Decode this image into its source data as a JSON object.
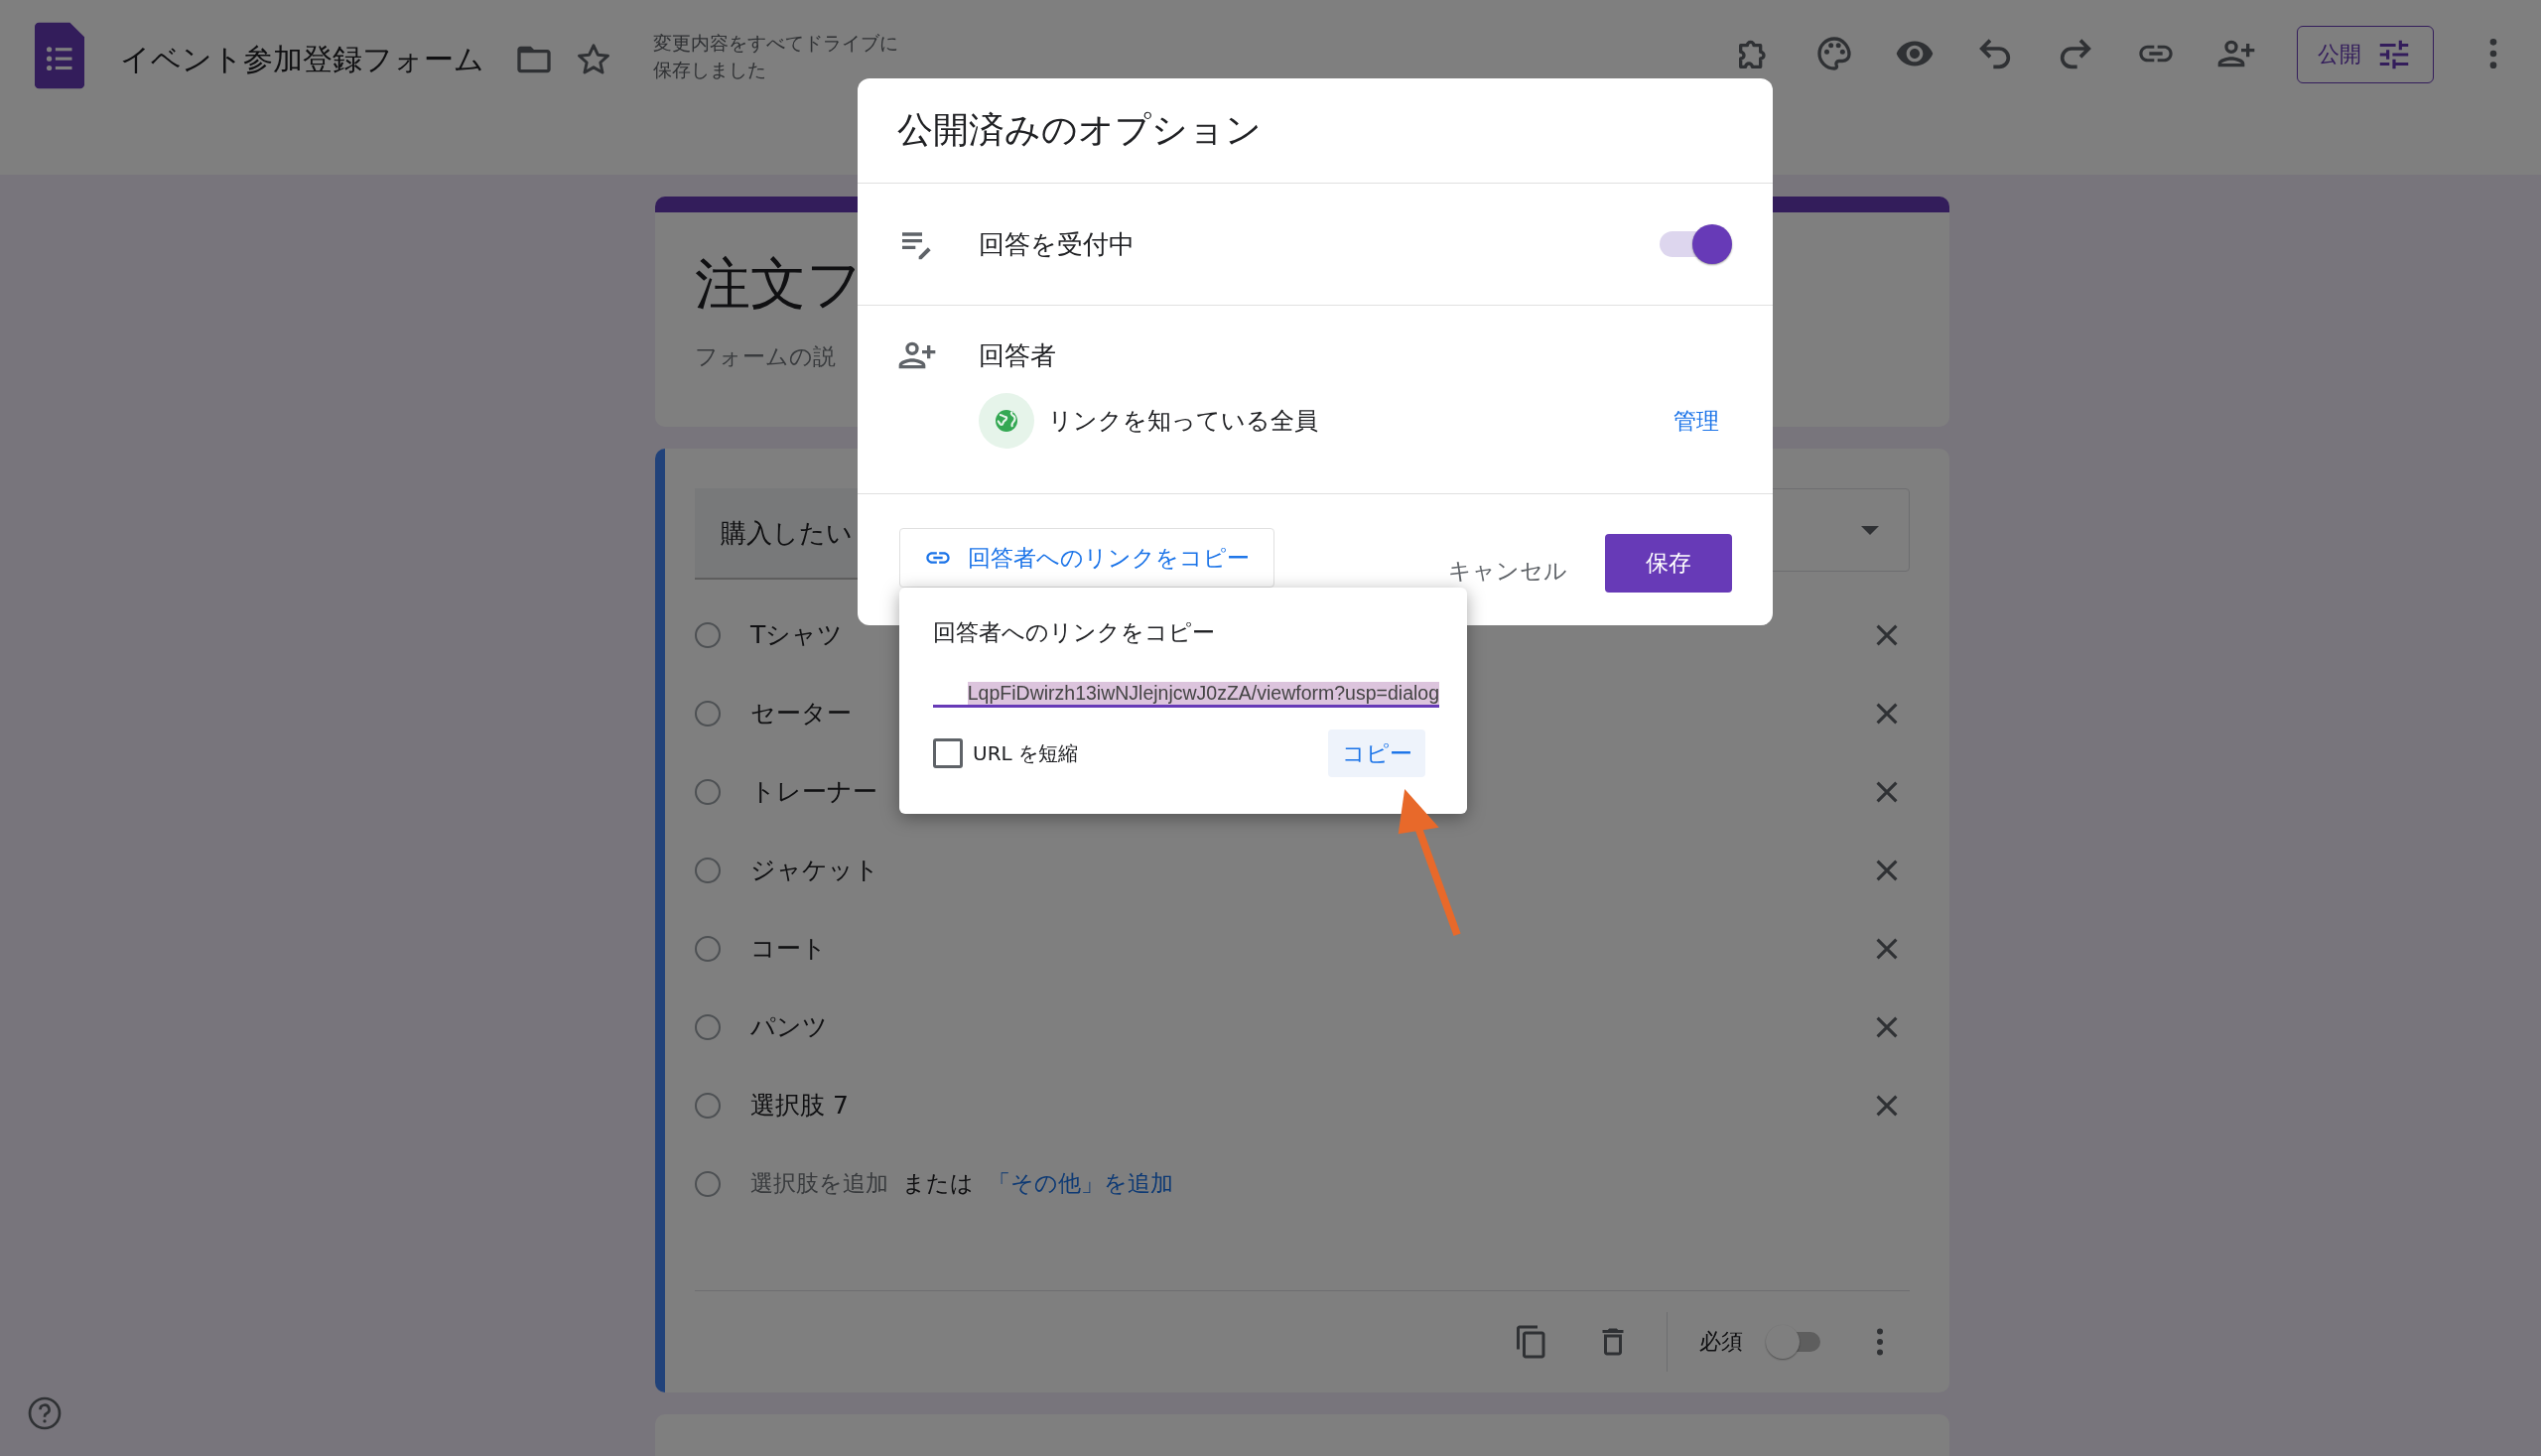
{
  "header": {
    "title": "イベント参加登録フォーム",
    "saved_status": [
      "変更内容をすべてドライブに",
      "保存しました"
    ],
    "publish_button": "公開"
  },
  "form": {
    "title": "注文フ",
    "description": "フォームの説",
    "question": {
      "title": "購入したい",
      "options": [
        {
          "label": "Tシャツ",
          "selected": false
        },
        {
          "label": "セーター",
          "selected": false
        },
        {
          "label": "トレーナー",
          "selected": false
        },
        {
          "label": "ジャケット",
          "selected": false
        },
        {
          "label": "コート",
          "selected": false
        },
        {
          "label": "パンツ",
          "selected": false
        },
        {
          "label": "選択肢 7",
          "selected": false
        }
      ],
      "add_row": {
        "selected": false,
        "add_option": "選択肢を追加",
        "or": "または",
        "add_other": "「その他」を追加"
      },
      "required_label": "必須",
      "required": false
    }
  },
  "dialog": {
    "title": "公開済みのオプション",
    "accepting": {
      "label": "回答を受付中",
      "on": true
    },
    "respondents": {
      "label": "回答者",
      "audience": "リンクを知っている全員",
      "manage": "管理"
    },
    "copy_link_button": "回答者へのリンクをコピー",
    "cancel": "キャンセル",
    "save": "保存"
  },
  "popup": {
    "title": "回答者へのリンクをコピー",
    "url": "LqpFiDwirzh13iwNJlejnjcwJ0zZA/viewform?usp=dialog",
    "shorten_label": "URL を短縮",
    "shorten": false,
    "copy": "コピー"
  }
}
